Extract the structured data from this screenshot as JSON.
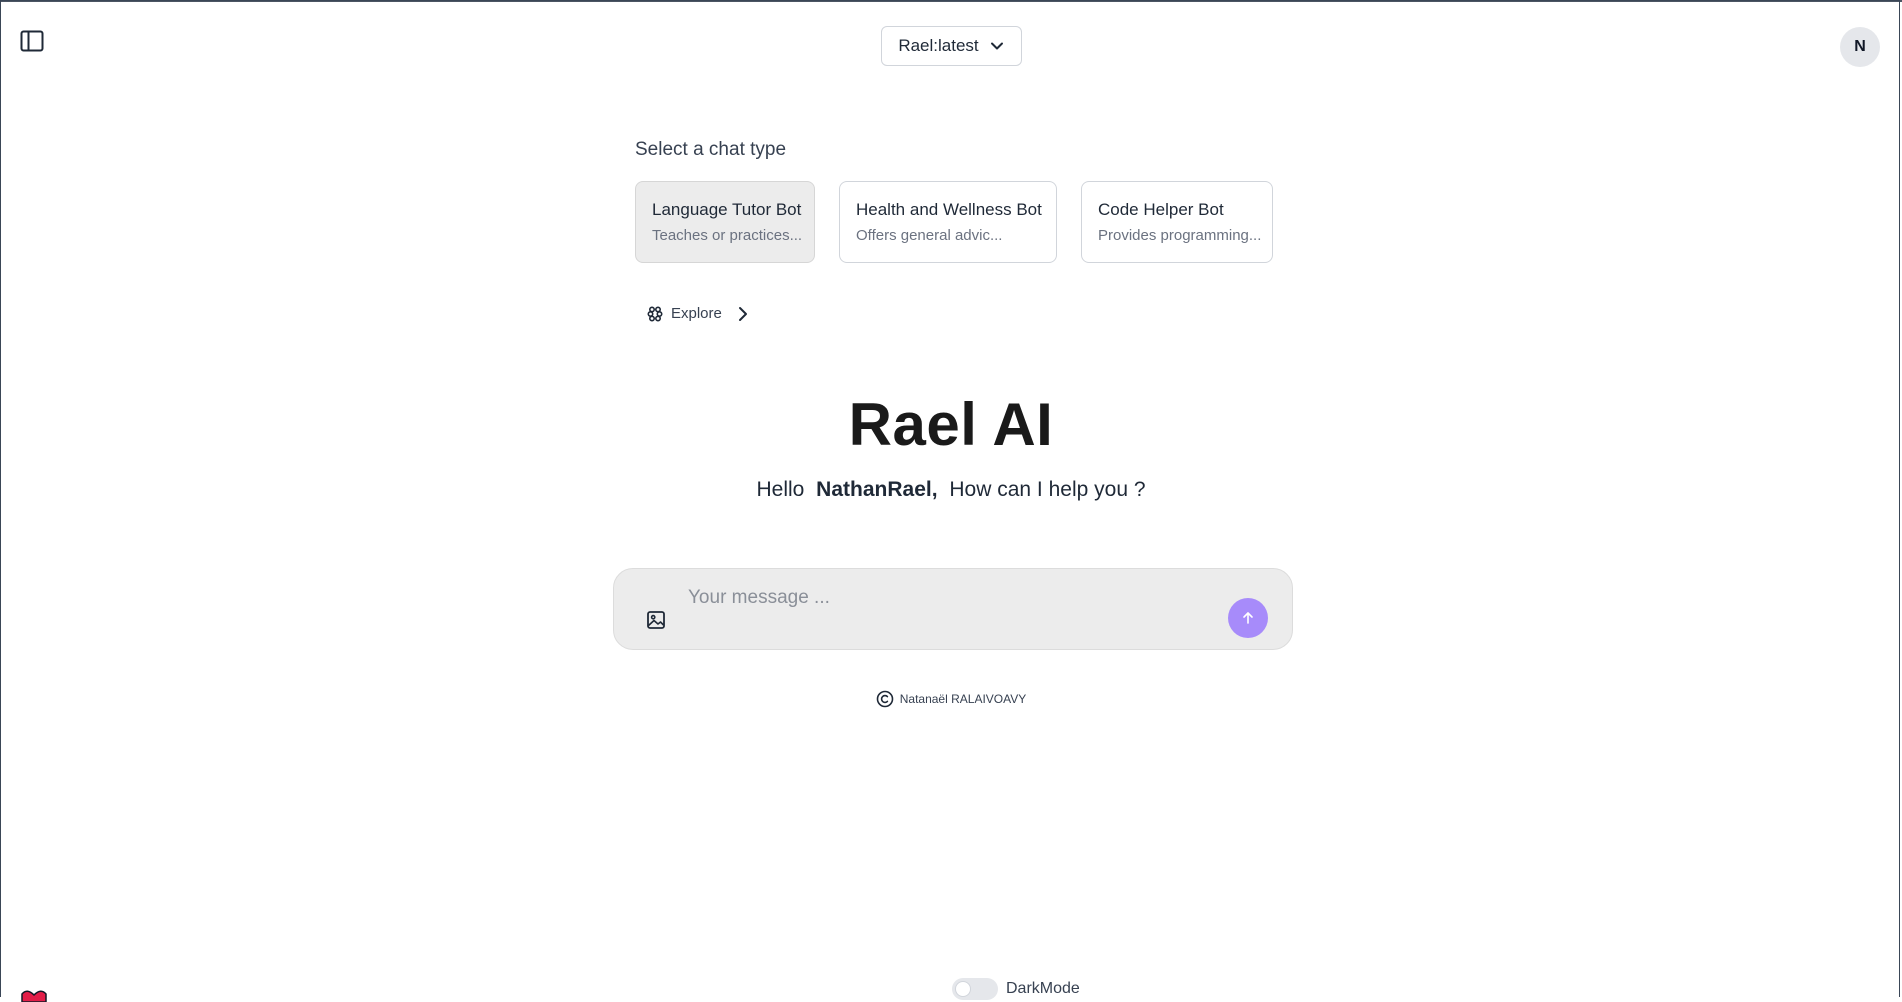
{
  "header": {
    "model_selector": {
      "value": "Rael:latest"
    },
    "avatar_initial": "N"
  },
  "chat_type": {
    "title": "Select a chat type",
    "cards": [
      {
        "title": "Language Tutor Bot",
        "description": "Teaches or practices...",
        "selected": true
      },
      {
        "title": "Health and Wellness Bot",
        "description": "Offers general advic...",
        "selected": false
      },
      {
        "title": "Code Helper Bot",
        "description": "Provides programming...",
        "selected": false
      }
    ],
    "explore_label": "Explore"
  },
  "hero": {
    "title": "Rael AI",
    "greeting_prefix": "Hello",
    "user_name": "NathanRael,",
    "greeting_suffix": "How can I help you ?"
  },
  "composer": {
    "placeholder": "Your message ..."
  },
  "footer": {
    "copyright_name": "Natanaël RALAIVOAVY",
    "darkmode_label": "DarkMode",
    "darkmode_on": false
  },
  "colors": {
    "accent": "#a78bfa",
    "composer_bg": "#ececec",
    "selected_card_bg": "#ececec"
  },
  "icons": {
    "sidebar_toggle": "sidebar-panel-icon",
    "model_chevron": "chevron-down-icon",
    "explore": "grid-star-icon",
    "explore_arrow": "chevron-right-icon",
    "image_upload": "image-icon",
    "send": "arrow-up-icon",
    "copyright": "copyright-icon",
    "corner": "heart-logo-icon"
  }
}
